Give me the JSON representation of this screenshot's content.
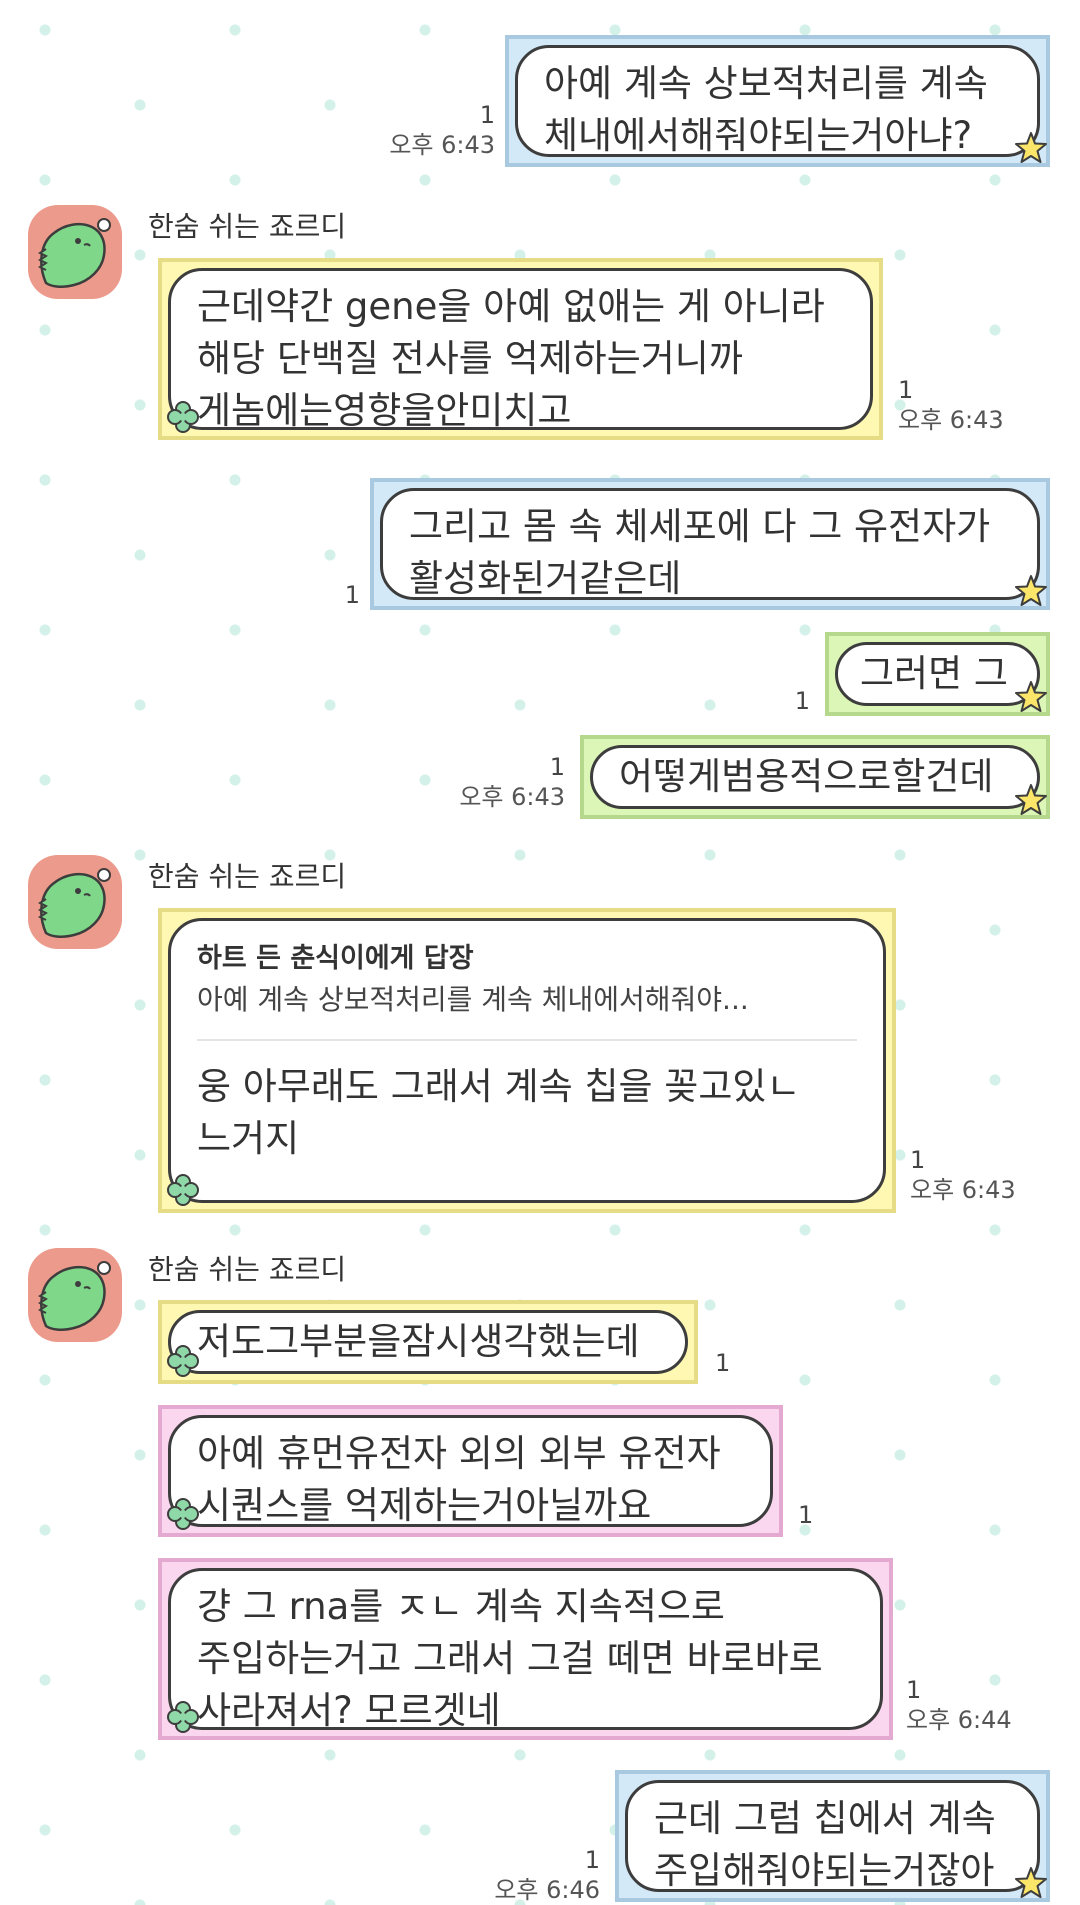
{
  "sender_name": "한숨 쉬는 죠르디",
  "messages": [
    {
      "lines": [
        "아예 계속 상보적처리를 계속",
        "체내에서해줘야되는거아냐?"
      ],
      "unread": "1",
      "time": "오후 6:43"
    },
    {
      "lines": [
        "근데약간 gene을 아예 없애는 게 아니라",
        "해당 단백질 전사를 억제하는거니까",
        "게놈에는영향을안미치고"
      ],
      "unread": "1",
      "time": "오후 6:43"
    },
    {
      "lines": [
        "그리고 몸 속 체세포에 다 그 유전자가",
        "활성화된거같은데"
      ],
      "unread": "1"
    },
    {
      "lines": [
        "그러면 그"
      ],
      "unread": "1"
    },
    {
      "lines": [
        "어떻게범용적으로할건데"
      ],
      "unread": "1",
      "time": "오후 6:43"
    },
    {
      "reply_to": "하트 든 춘식이에게 답장",
      "quote": "아예 계속 상보적처리를 계속 체내에서해줘야...",
      "lines": [
        "웅 아무래도 그래서 계속 칩을 꽂고있ㄴ",
        "느거지"
      ],
      "unread": "1",
      "time": "오후 6:43"
    },
    {
      "lines": [
        "저도그부분을잠시생각했는데"
      ],
      "unread": "1"
    },
    {
      "lines": [
        "아예 휴먼유전자 외의 외부 유전자",
        "시퀀스를 억제하는거아닐까요"
      ],
      "unread": "1"
    },
    {
      "lines": [
        "걍 그 rna를 ㅈㄴ 계속 지속적으로",
        "주입하는거고 그래서 그걸 떼면 바로바로",
        "사라져서? 모르겟네"
      ],
      "unread": "1",
      "time": "오후 6:44"
    },
    {
      "lines": [
        "근데 그럼 칩에서 계속",
        "주입해줘야되는거잖아"
      ],
      "unread": "1",
      "time": "오후 6:46"
    }
  ],
  "colors": {
    "blue": "#d4e9f8",
    "yellow": "#fff8b2",
    "green": "#dcf6b7",
    "pink": "#fbd6ef",
    "avatar": "#ec9a8b"
  },
  "icons": {
    "sent_decoration": "star-icon",
    "received_decoration": "clover-icon",
    "avatar": "jordy-dinosaur-avatar"
  }
}
